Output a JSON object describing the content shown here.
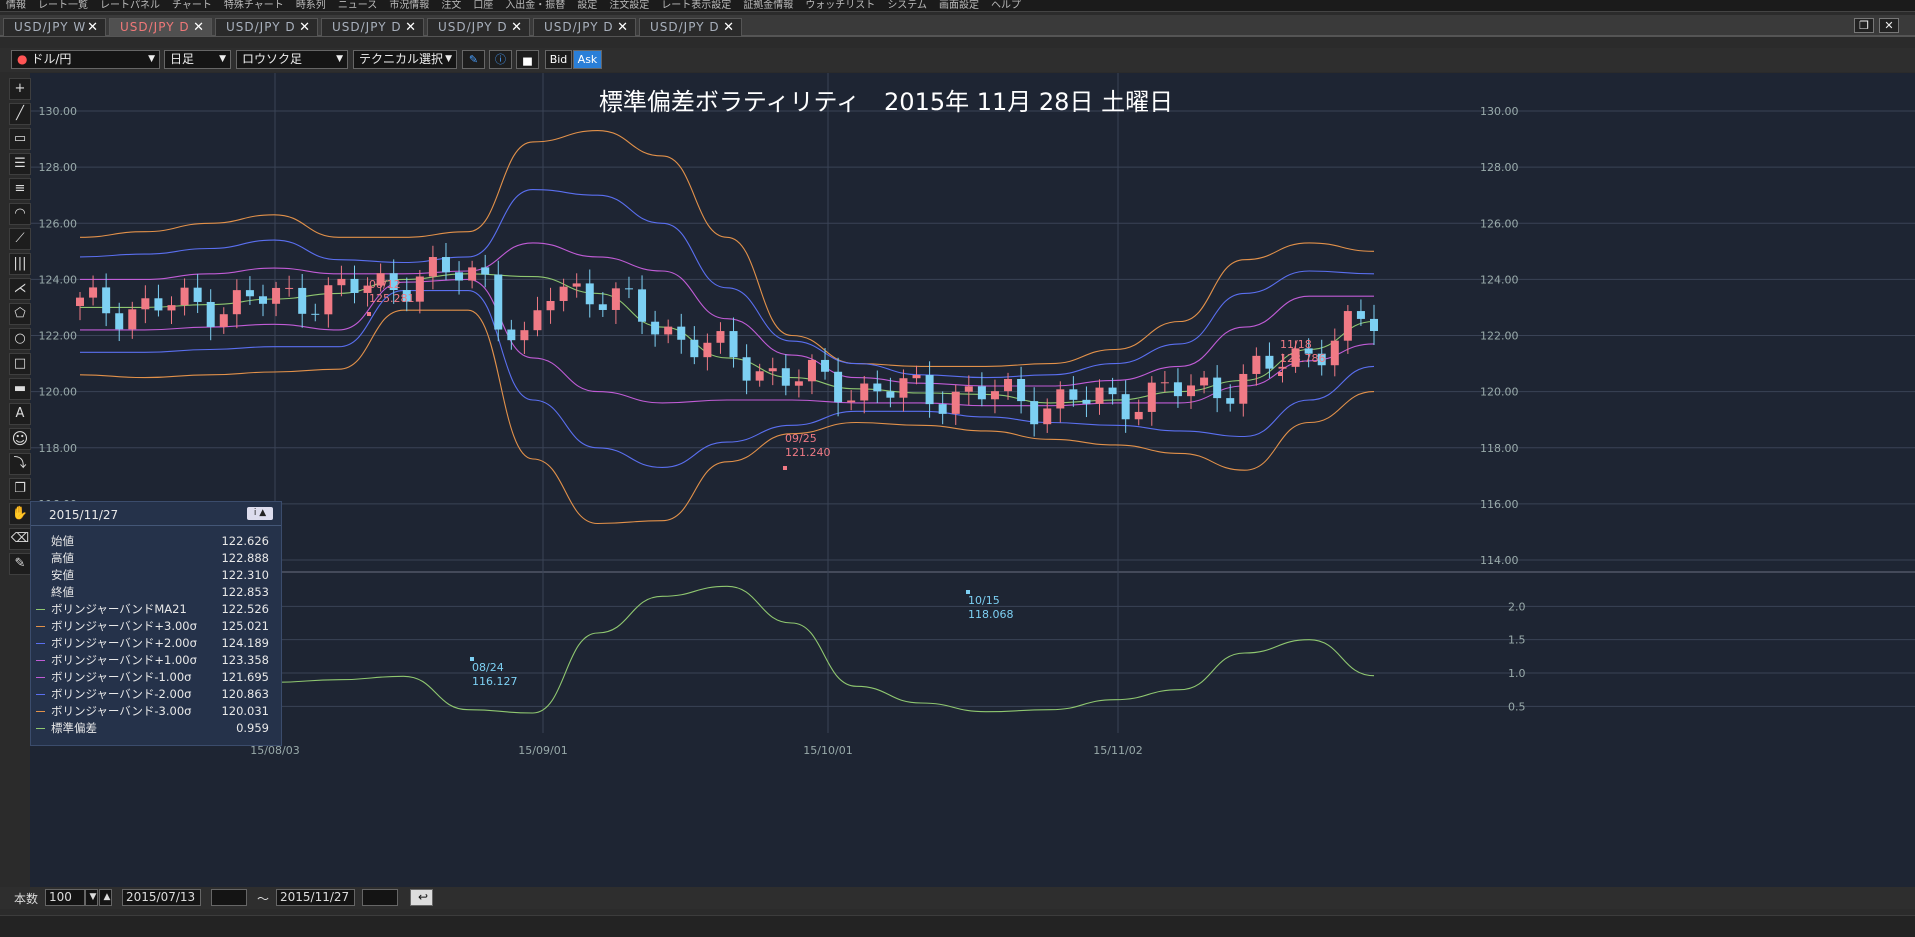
{
  "menu": [
    "情報",
    "レート一覧",
    "レートパネル",
    "チャート",
    "特殊チャート",
    "時系列",
    "ニュース",
    "市況情報",
    "",
    "注文",
    "口座",
    "入出金・振替",
    "",
    "設定",
    "注文設定",
    "レート表示設定",
    "証拠金情報",
    "ウォッチリスト",
    "システム",
    "画面設定",
    "ヘルプ"
  ],
  "tabs": [
    {
      "label": "USD/JPY W",
      "active": false
    },
    {
      "label": "USD/JPY D",
      "active": true
    },
    {
      "label": "USD/JPY D",
      "active": false
    },
    {
      "label": "USD/JPY D",
      "active": false
    },
    {
      "label": "USD/JPY D",
      "active": false
    },
    {
      "label": "USD/JPY D",
      "active": false
    },
    {
      "label": "USD/JPY D",
      "active": false
    }
  ],
  "toolbar": {
    "pair": "ドル/円",
    "timeframe": "日足",
    "chart_type": "ロウソク足",
    "technical": "テクニカル選択",
    "bid": "Bid",
    "ask": "Ask"
  },
  "chart_data": {
    "type": "line",
    "title": "標準偏差ボラティリティ　2015年 11月 28日 土曜日",
    "upper_ticks": [
      "130.00",
      "128.00",
      "126.00",
      "124.00",
      "122.00",
      "120.00",
      "118.00",
      "116.00",
      "114.00"
    ],
    "lower_ticks": [
      "2.0",
      "1.5",
      "1.0",
      "0.5"
    ],
    "x_ticks": [
      "15/08/03",
      "15/09/01",
      "15/10/01",
      "15/11/02"
    ],
    "annotations": [
      {
        "date": "08/12",
        "value": "125.281"
      },
      {
        "date": "08/24",
        "value": "116.127"
      },
      {
        "date": "09/25",
        "value": "121.240"
      },
      {
        "date": "10/15",
        "value": "118.068"
      },
      {
        "date": "11/18",
        "value": "123.786"
      }
    ],
    "series": [
      {
        "name": "ボリンジャーバンドMA21",
        "color": "#8fc770",
        "values": [
          123.0,
          123.0,
          123.1,
          123.3,
          123.5,
          124.0,
          124.2,
          124.1,
          123.5,
          122.3,
          121.2,
          120.5,
          120.1,
          119.95,
          119.9,
          119.6,
          119.7,
          120.0,
          120.4,
          121.5,
          122.5
        ]
      },
      {
        "name": "ボリンジャーバンド+3.00σ",
        "color": "#e2914a",
        "values": [
          125.5,
          125.7,
          126.0,
          126.3,
          125.5,
          125.5,
          125.7,
          128.9,
          129.3,
          128.4,
          125.5,
          122.0,
          121.0,
          120.9,
          120.9,
          121.0,
          121.5,
          122.5,
          124.7,
          125.3,
          125.0
        ]
      },
      {
        "name": "ボリンジャーバンド+2.00σ",
        "color": "#5a6ff0",
        "values": [
          124.8,
          124.9,
          125.1,
          125.4,
          124.7,
          124.6,
          124.8,
          127.2,
          127.0,
          126.0,
          123.7,
          121.8,
          121.0,
          120.6,
          120.5,
          120.6,
          121.0,
          121.7,
          123.5,
          124.3,
          124.2
        ]
      },
      {
        "name": "ボリンジャーバンド+1.00σ",
        "color": "#c05cd6",
        "values": [
          124.0,
          124.0,
          124.2,
          124.4,
          124.2,
          124.2,
          124.3,
          125.3,
          124.8,
          124.3,
          122.6,
          121.3,
          120.5,
          120.3,
          120.2,
          120.2,
          120.4,
          120.9,
          122.3,
          123.4,
          123.4
        ]
      },
      {
        "name": "ボリンジャーバンド-1.00σ",
        "color": "#c05cd6",
        "values": [
          122.2,
          122.2,
          122.3,
          122.4,
          122.2,
          123.9,
          124.0,
          121.2,
          120.0,
          119.6,
          119.7,
          119.7,
          119.6,
          119.6,
          119.5,
          119.5,
          119.6,
          119.6,
          120.2,
          121.1,
          121.7
        ]
      },
      {
        "name": "ボリンジャーバンド-2.00σ",
        "color": "#5a6ff0",
        "values": [
          121.4,
          121.4,
          121.5,
          121.6,
          121.6,
          123.6,
          123.6,
          119.7,
          118.0,
          117.3,
          118.2,
          118.8,
          119.3,
          119.3,
          119.1,
          118.9,
          118.8,
          118.6,
          118.4,
          119.7,
          120.9
        ]
      },
      {
        "name": "ボリンジャーバンド-3.00σ",
        "color": "#e2914a",
        "values": [
          120.6,
          120.5,
          120.6,
          120.7,
          120.8,
          122.9,
          122.9,
          117.6,
          115.3,
          115.4,
          117.5,
          118.5,
          118.9,
          118.8,
          118.6,
          118.3,
          118.1,
          117.8,
          117.2,
          118.9,
          120.0
        ]
      },
      {
        "name": "標準偏差",
        "color": "#8fc770",
        "values": [
          0.8,
          0.77,
          0.83,
          0.86,
          0.9,
          0.95,
          0.45,
          0.4,
          1.6,
          2.15,
          2.3,
          1.75,
          0.8,
          0.55,
          0.42,
          0.45,
          0.6,
          0.75,
          1.3,
          1.5,
          0.96
        ]
      }
    ]
  },
  "info": {
    "date": "2015/11/27",
    "rows": [
      {
        "label": "始値",
        "value": "122.626",
        "color": ""
      },
      {
        "label": "高値",
        "value": "122.888",
        "color": ""
      },
      {
        "label": "安値",
        "value": "122.310",
        "color": ""
      },
      {
        "label": "終値",
        "value": "122.853",
        "color": ""
      },
      {
        "label": "ボリンジャーバンドMA21",
        "value": "122.526",
        "color": "#8fc770"
      },
      {
        "label": "ボリンジャーバンド+3.00σ",
        "value": "125.021",
        "color": "#e2914a"
      },
      {
        "label": "ボリンジャーバンド+2.00σ",
        "value": "124.189",
        "color": "#5a6ff0"
      },
      {
        "label": "ボリンジャーバンド+1.00σ",
        "value": "123.358",
        "color": "#c05cd6"
      },
      {
        "label": "ボリンジャーバンド-1.00σ",
        "value": "121.695",
        "color": "#c05cd6"
      },
      {
        "label": "ボリンジャーバンド-2.00σ",
        "value": "120.863",
        "color": "#5a6ff0"
      },
      {
        "label": "ボリンジャーバンド-3.00σ",
        "value": "120.031",
        "color": "#e2914a"
      },
      {
        "label": "標準偏差",
        "value": "0.959",
        "color": "#8fc770"
      }
    ]
  },
  "bottom": {
    "count_label": "本数",
    "count": "100",
    "start": "2015/07/13",
    "tilde": "〜",
    "end": "2015/11/27"
  }
}
